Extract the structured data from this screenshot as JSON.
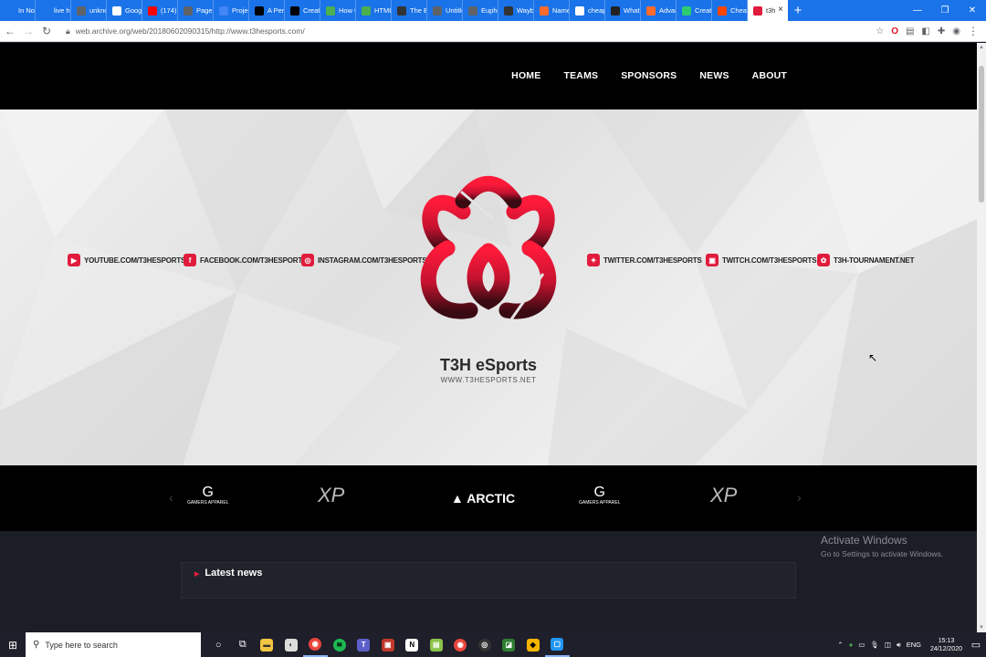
{
  "browser": {
    "tabs": [
      {
        "label": "In Not",
        "icon": "bracket-icon",
        "color": "#1a73e8"
      },
      {
        "label": "live ht",
        "icon": "globe-icon",
        "color": "#1a73e8"
      },
      {
        "label": "unkno",
        "icon": "globe-icon",
        "color": "#5f6368"
      },
      {
        "label": "Googl",
        "icon": "google-icon",
        "color": "#ffffff"
      },
      {
        "label": "(174) Y",
        "icon": "youtube-icon",
        "color": "#ff0000"
      },
      {
        "label": "Page r",
        "icon": "globe-icon",
        "color": "#5f6368"
      },
      {
        "label": "Projec",
        "icon": "docs-icon",
        "color": "#4285f4"
      },
      {
        "label": "A Pen",
        "icon": "codepen-icon",
        "color": "#000000"
      },
      {
        "label": "Create",
        "icon": "codepen-icon",
        "color": "#000000"
      },
      {
        "label": "How t",
        "icon": "w3-icon",
        "color": "#4caf50"
      },
      {
        "label": "HTML",
        "icon": "w3-icon",
        "color": "#4caf50"
      },
      {
        "label": "The Ex",
        "icon": "file-icon",
        "color": "#333333"
      },
      {
        "label": "Untitle",
        "icon": "globe-icon",
        "color": "#5f6368"
      },
      {
        "label": "Eupho",
        "icon": "globe-icon",
        "color": "#5f6368"
      },
      {
        "label": "Wayba",
        "icon": "archive-icon",
        "color": "#333333"
      },
      {
        "label": "Name",
        "icon": "namecheap-icon",
        "color": "#ff6b2c"
      },
      {
        "label": "cheap",
        "icon": "google-icon",
        "color": "#ffffff"
      },
      {
        "label": "What's",
        "icon": "ih-icon",
        "color": "#222222"
      },
      {
        "label": "Advan",
        "icon": "namecheap-icon",
        "color": "#ff6b2c"
      },
      {
        "label": "Create",
        "icon": "diamond-icon",
        "color": "#2ecc71"
      },
      {
        "label": "Cheap",
        "icon": "reddit-icon",
        "color": "#ff4500"
      }
    ],
    "active_tab": {
      "label": "t3h",
      "close": "×"
    },
    "new_tab": "+",
    "window_controls": {
      "minimize": "—",
      "restore": "❐",
      "close": "✕"
    },
    "url": "web.archive.org/web/20180602090315/http://www.t3hesports.com/"
  },
  "site": {
    "nav": [
      "HOME",
      "TEAMS",
      "SPONSORS",
      "NEWS",
      "ABOUT"
    ],
    "social_left": [
      {
        "label": "YOUTUBE.COM/T3HESPORTS",
        "icon": "youtube-icon",
        "color": "#e01b3c"
      },
      {
        "label": "FACEBOOK.COM/T3HESPORTS",
        "icon": "facebook-icon",
        "color": "#e01b3c"
      },
      {
        "label": "INSTAGRAM.COM/T3HESPORTS",
        "icon": "instagram-icon",
        "color": "#e01b3c"
      }
    ],
    "social_right": [
      {
        "label": "TWITTER.COM/T3HESPORTS",
        "icon": "twitter-icon",
        "color": "#e01b3c"
      },
      {
        "label": "TWITCH.COM/T3HESPORTS",
        "icon": "twitch-icon",
        "color": "#e01b3c"
      },
      {
        "label": "T3H-TOURNAMENT.NET",
        "icon": "t3h-icon",
        "color": "#e01b3c"
      }
    ],
    "logo_title": "T3H eSports",
    "logo_subtitle": "WWW.T3HESPORTS.NET",
    "sponsors": [
      {
        "name": "GAMERS APPAREL",
        "type": "gamers"
      },
      {
        "name": "XP",
        "type": "xp"
      },
      {
        "name": "ARCTIC",
        "type": "arctic"
      },
      {
        "name": "GAMERS APPAREL",
        "type": "gamers"
      },
      {
        "name": "XP",
        "type": "xp"
      }
    ],
    "sponsor_prev": "‹",
    "sponsor_next": "›",
    "latest_news": "Latest news",
    "accent": "#e01b3c"
  },
  "activation": {
    "title": "Activate Windows",
    "subtitle": "Go to Settings to activate Windows."
  },
  "taskbar": {
    "search_placeholder": "Type here to search",
    "language": "ENG",
    "time": "15:13",
    "date": "24/12/2020"
  }
}
